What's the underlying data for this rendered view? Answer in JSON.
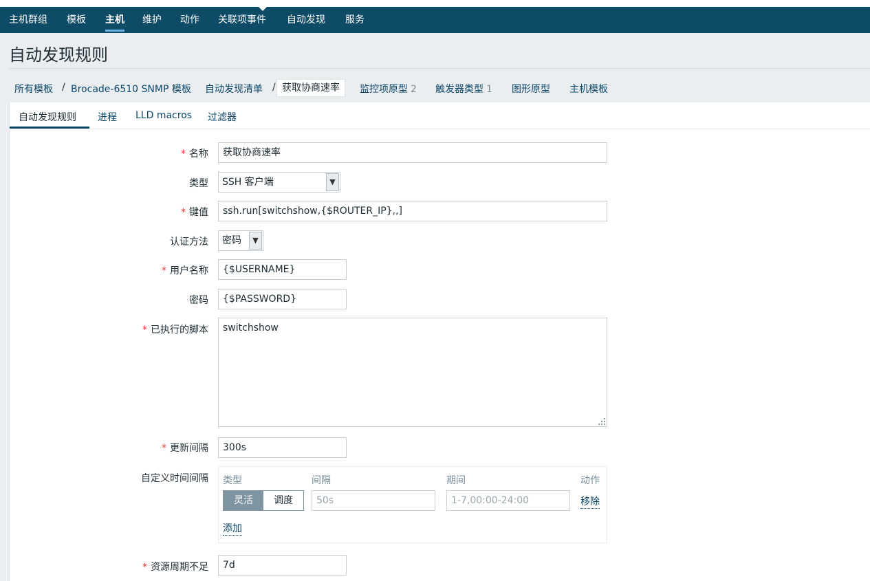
{
  "nav": {
    "items": [
      "主机群组",
      "模板",
      "主机",
      "维护",
      "动作",
      "关联项事件",
      "自动发现",
      "服务"
    ],
    "active": "主机"
  },
  "page_title": "自动发现规则",
  "breadcrumb": {
    "all_templates": "所有模板",
    "sep": "/",
    "template": "Brocade-6510 SNMP 模板",
    "discovery_list": "自动发现清单",
    "current": "获取协商速率",
    "item_prototypes": "监控项原型",
    "item_prototypes_count": "2",
    "trigger_types": "触发器类型",
    "trigger_types_count": "1",
    "graph_prototypes": "图形原型",
    "host_templates": "主机模板"
  },
  "tabs": [
    "自动发现规则",
    "进程",
    "LLD macros",
    "过滤器"
  ],
  "form": {
    "name_label": "名称",
    "name_value": "获取协商速率",
    "type_label": "类型",
    "type_value": "SSH 客户端",
    "key_label": "键值",
    "key_value": "ssh.run[switchshow,{$ROUTER_IP},,]",
    "auth_label": "认证方法",
    "auth_value": "密码",
    "username_label": "用户名称",
    "username_value": "{$USERNAME}",
    "password_label": "密码",
    "password_value": "{$PASSWORD}",
    "script_label": "已执行的脚本",
    "script_value": "switchshow",
    "interval_label": "更新间隔",
    "interval_value": "300s",
    "custom_intervals_label": "自定义时间间隔",
    "custom_intervals": {
      "col_type": "类型",
      "col_interval": "间隔",
      "col_period": "期间",
      "col_action": "动作",
      "flexible": "灵活",
      "scheduling": "调度",
      "interval_placeholder": "50s",
      "period_placeholder": "1-7,00:00-24:00",
      "remove": "移除",
      "add": "添加"
    },
    "keep_lost_label": "资源周期不足",
    "keep_lost_value": "7d"
  },
  "colors": {
    "nav_bg": "#0e4b67",
    "link": "#0a466a",
    "required": "#e33734"
  }
}
